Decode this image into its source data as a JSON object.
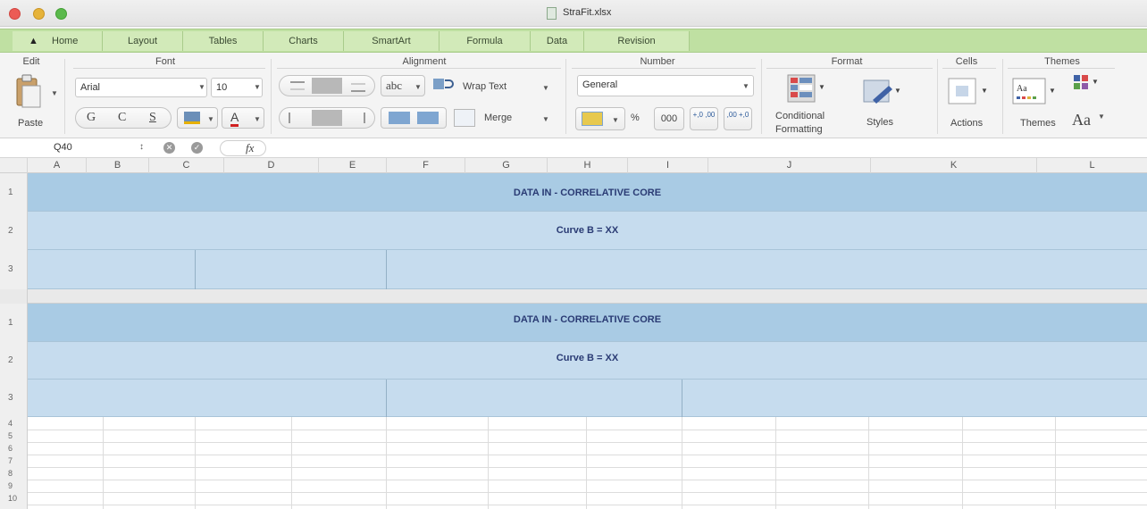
{
  "window": {
    "title": "StraFit.xlsx",
    "colors": {
      "close": "#ec5b55",
      "minimize": "#e6b33a",
      "zoom": "#5bb94c"
    }
  },
  "ribbon_tabs": [
    {
      "label": "Home",
      "icon": "home-icon"
    },
    {
      "label": "Layout"
    },
    {
      "label": "Tables"
    },
    {
      "label": "Charts"
    },
    {
      "label": "SmartArt"
    },
    {
      "label": "Formula"
    },
    {
      "label": "Data"
    },
    {
      "label": "Revision"
    }
  ],
  "groups": {
    "edit": {
      "label": "Edit",
      "paste": "Paste"
    },
    "font": {
      "label": "Font",
      "name": "Arial",
      "size": "10",
      "bold": "G",
      "italic": "C",
      "underline": "S",
      "font_color": "A"
    },
    "alignment": {
      "label": "Alignment",
      "abc": "abc",
      "wrap_text": "Wrap Text",
      "merge": "Merge"
    },
    "number": {
      "label": "Number",
      "format": "General",
      "percent": "%",
      "thousands": "000",
      "inc_decimal": "+,0 ,00",
      "dec_decimal": ",00 +,0"
    },
    "format": {
      "label": "Format",
      "conditional": "Conditional Formatting",
      "styles": "Styles"
    },
    "cells": {
      "label": "Cells",
      "actions": "Actions"
    },
    "themes": {
      "label": "Themes",
      "themes": "Themes",
      "font_aa": "Aa"
    }
  },
  "formula_bar": {
    "cell_ref": "Q40",
    "fx": "fx",
    "value": ""
  },
  "columns": [
    "A",
    "B",
    "C",
    "D",
    "E",
    "F",
    "G",
    "H",
    "I",
    "J",
    "K",
    "L"
  ],
  "tables": [
    {
      "rows": [
        "1",
        "2",
        "3"
      ],
      "header": "DATA IN - CORRELATIVE CORE",
      "subheader": "Curve B = XX"
    },
    {
      "rows": [
        "1",
        "2",
        "3"
      ],
      "header": "DATA IN - CORRELATIVE CORE",
      "subheader": "Curve B = XX"
    }
  ],
  "rows_below": [
    "4",
    "5",
    "6",
    "7",
    "8",
    "9",
    "10"
  ]
}
